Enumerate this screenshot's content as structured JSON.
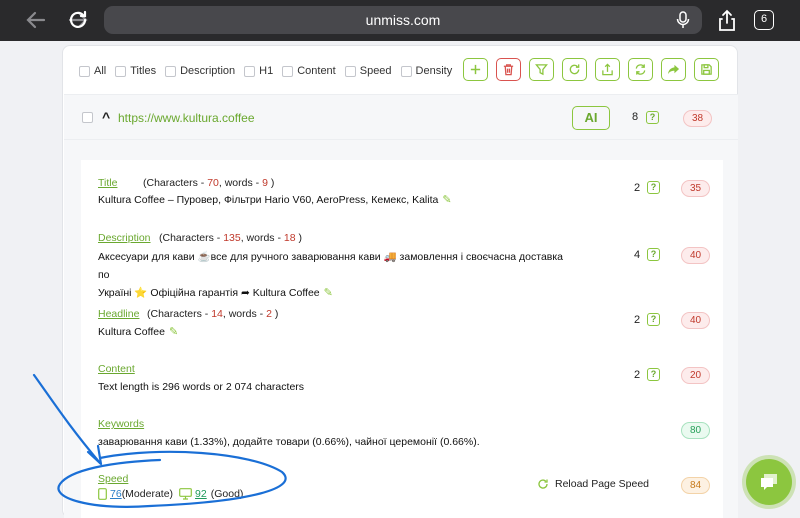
{
  "browser": {
    "url": "unmiss.com",
    "tab_count": "6"
  },
  "filters": [
    {
      "label": "All"
    },
    {
      "label": "Titles"
    },
    {
      "label": "Description"
    },
    {
      "label": "H1"
    },
    {
      "label": "Content"
    },
    {
      "label": "Speed"
    },
    {
      "label": "Density"
    }
  ],
  "toolbar": {
    "icons": [
      "plus-icon",
      "trash-icon",
      "filter-icon",
      "refresh-icon",
      "upload-icon",
      "sync-icon",
      "forward-icon",
      "save-icon"
    ]
  },
  "site": {
    "url": "https://www.kultura.coffee",
    "ai_label": "AI",
    "comments_count": "8",
    "score": "38"
  },
  "sections": {
    "title": {
      "heading": "Title",
      "meta_prefix": "(Characters - ",
      "chars": "70",
      "meta_mid": ", words - ",
      "words": "9",
      "meta_suffix": " )",
      "text": "Kultura Coffee – Пуровер, Фільтри Hario V60, AeroPress, Кемекс, Kalita",
      "count": "2",
      "score": "35"
    },
    "description": {
      "heading": "Description",
      "meta_prefix": "(Characters - ",
      "chars": "135",
      "meta_mid": ", words - ",
      "words": "18",
      "meta_suffix": " )",
      "text_line1": "Аксесуари для кави ☕все для ручного заварювання кави 🚚 замовлення і своєчасна доставка по",
      "text_line2": "Україні ⭐ Офіційна гарантія ➦ Kultura Coffee",
      "count": "4",
      "score": "40"
    },
    "headline": {
      "heading": "Headline",
      "meta_prefix": "(Characters - ",
      "chars": "14",
      "meta_mid": ", words - ",
      "words": "2",
      "meta_suffix": " )",
      "text": "Kultura Coffee",
      "count": "2",
      "score": "40"
    },
    "content": {
      "heading": "Content",
      "text": "Text length is 296 words or 2 074 characters",
      "count": "2",
      "score": "20"
    },
    "keywords": {
      "heading": "Keywords",
      "text": "заварювання кави (1.33%), додайте товари (0.66%), чайної церемонії (0.66%).",
      "score": "80"
    },
    "speed": {
      "heading": "Speed",
      "mobile_score": "76",
      "mobile_label": "(Moderate)",
      "desktop_score": "92",
      "desktop_label": "(Good)",
      "reload_label": "Reload Page Speed",
      "score": "84"
    }
  },
  "colors": {
    "accent": "#8cc63f",
    "danger": "#d9534f",
    "annotation": "#1a6fd6"
  }
}
